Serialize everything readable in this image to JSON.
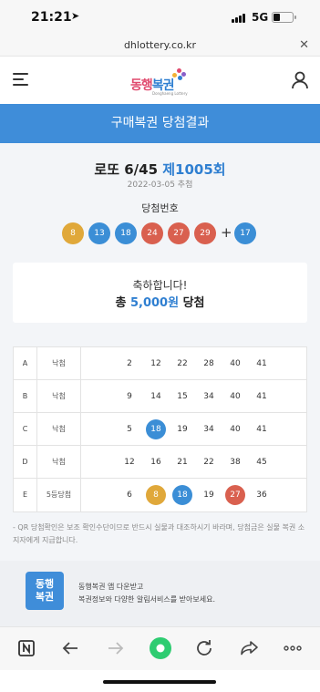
{
  "status_bar": {
    "time": "21:21",
    "network": "5G",
    "battery_level": 0.35
  },
  "browser": {
    "url": "dhlottery.co.kr"
  },
  "site": {
    "logo_text_1": "동행",
    "logo_text_2": "복권",
    "logo_sub": "Donghaeng Lottery"
  },
  "banner": {
    "title": "구매복권 당첨결과"
  },
  "draw": {
    "game": "로또 6/45",
    "round": "제1005회",
    "date": "2022-03-05 추첨",
    "winning_label": "당첨번호",
    "numbers": [
      "8",
      "13",
      "18",
      "24",
      "27",
      "29"
    ],
    "bonus_symbol": "+",
    "bonus": "17"
  },
  "result": {
    "message": "축하합니다!",
    "prize_prefix": "총",
    "prize_amount": "5,000원",
    "prize_suffix": "당첨"
  },
  "games": [
    {
      "id": "A",
      "mode": "낙첨",
      "numbers": [
        "2",
        "12",
        "22",
        "28",
        "40",
        "41"
      ],
      "hits": [
        false,
        false,
        false,
        false,
        false,
        false
      ]
    },
    {
      "id": "B",
      "mode": "낙첨",
      "numbers": [
        "9",
        "14",
        "15",
        "34",
        "40",
        "41"
      ],
      "hits": [
        false,
        false,
        false,
        false,
        false,
        false
      ]
    },
    {
      "id": "C",
      "mode": "낙첨",
      "numbers": [
        "5",
        "18",
        "19",
        "34",
        "40",
        "41"
      ],
      "hits": [
        false,
        true,
        false,
        false,
        false,
        false
      ]
    },
    {
      "id": "D",
      "mode": "낙첨",
      "numbers": [
        "12",
        "16",
        "21",
        "22",
        "38",
        "45"
      ],
      "hits": [
        false,
        false,
        false,
        false,
        false,
        false
      ]
    },
    {
      "id": "E",
      "mode": "5등당첨",
      "numbers": [
        "6",
        "8",
        "18",
        "19",
        "27",
        "36"
      ],
      "hits": [
        false,
        true,
        true,
        false,
        true,
        false
      ]
    }
  ],
  "notice": "- QR 당첨확인은 보조 확인수단이므로 반드시 실물과 대조하시기 바라며, 당첨금은 실물 복권 소지자에게 지급합니다.",
  "app_promo": {
    "icon_line1": "동행",
    "icon_line2": "복권",
    "line1": "동행복권 앱 다운받고",
    "line2": "복권정보와 다양한 알림서비스를 받아보세요."
  },
  "colors": {
    "accent": "#3f8dd9",
    "ball_yellow": "#e0a83a",
    "ball_blue": "#3b8ed6",
    "ball_red": "#d9604f",
    "ball_green": "#2ecc71"
  }
}
